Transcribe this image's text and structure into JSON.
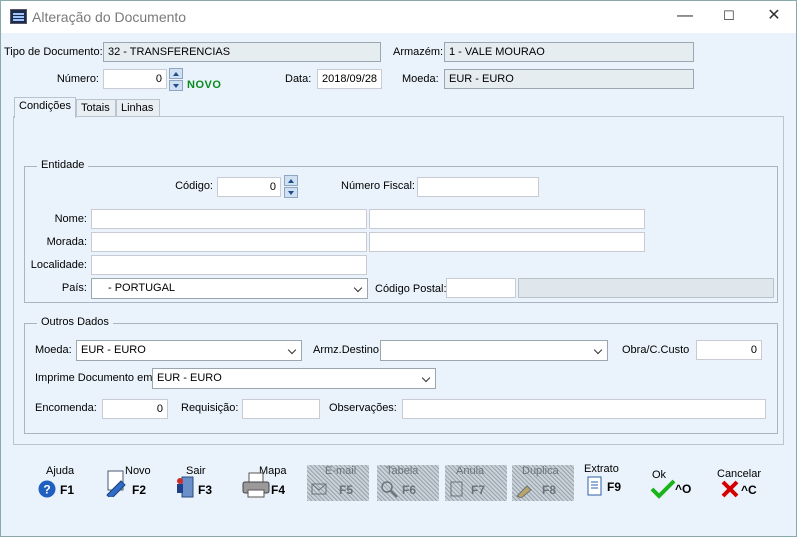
{
  "window": {
    "title": "Alteração do Documento"
  },
  "header": {
    "tipo_label": "Tipo de Documento:",
    "tipo_value": "32 - TRANSFERENCIAS",
    "armazem_label": "Armazém:",
    "armazem_value": "1 - VALE MOURAO",
    "numero_label": "Número:",
    "numero_value": "0",
    "novo_badge": "NOVO",
    "data_label": "Data:",
    "data_value": "2018/09/28",
    "moeda_label": "Moeda:",
    "moeda_value": "EUR - EURO"
  },
  "tabs": [
    {
      "label": "Condições",
      "active": true
    },
    {
      "label": "Totais",
      "active": false
    },
    {
      "label": "Linhas",
      "active": false
    }
  ],
  "entidade": {
    "group_title": "Entidade",
    "codigo_label": "Código:",
    "codigo_value": "0",
    "nif_label": "Número Fiscal:",
    "nif_value": "",
    "nome_label": "Nome:",
    "morada_label": "Morada:",
    "localidade_label": "Localidade:",
    "pais_label": "País:",
    "pais_value": "- PORTUGAL",
    "cp_label": "Código Postal:"
  },
  "outros": {
    "group_title": "Outros Dados",
    "moeda_label": "Moeda:",
    "moeda_value": "EUR - EURO",
    "armz_label": "Armz.Destino:",
    "armz_value": "",
    "obra_label": "Obra/C.Custo",
    "obra_value": "0",
    "imprime_label": "Imprime Documento em:",
    "imprime_value": "EUR - EURO",
    "encomenda_label": "Encomenda:",
    "encomenda_value": "0",
    "requisicao_label": "Requisição:",
    "observacoes_label": "Observações:"
  },
  "toolbar": [
    {
      "label": "Ajuda",
      "key": "F1",
      "icon": "help-icon",
      "enabled": true
    },
    {
      "label": "Novo",
      "key": "F2",
      "icon": "new-document-icon",
      "enabled": true
    },
    {
      "label": "Sair",
      "key": "F3",
      "icon": "exit-door-icon",
      "enabled": true
    },
    {
      "label": "Mapa",
      "key": "F4",
      "icon": "printer-icon",
      "enabled": true
    },
    {
      "label": "E-mail",
      "key": "F5",
      "icon": "email-icon",
      "enabled": false
    },
    {
      "label": "Tabela",
      "key": "F6",
      "icon": "table-search-icon",
      "enabled": false
    },
    {
      "label": "Anula",
      "key": "F7",
      "icon": "cancel-document-icon",
      "enabled": false
    },
    {
      "label": "Duplica",
      "key": "F8",
      "icon": "duplicate-icon",
      "enabled": false
    },
    {
      "label": "Extrato",
      "key": "F9",
      "icon": "statement-icon",
      "enabled": true
    },
    {
      "label": "Ok",
      "key": "^O",
      "icon": "ok-check-icon",
      "enabled": true
    },
    {
      "label": "Cancelar",
      "key": "^C",
      "icon": "cancel-x-icon",
      "enabled": true
    }
  ],
  "colors": {
    "novo": "#0a8a1e",
    "ok": "#1bb31b",
    "cancel": "#d40000",
    "help": "#1f5fbf"
  }
}
